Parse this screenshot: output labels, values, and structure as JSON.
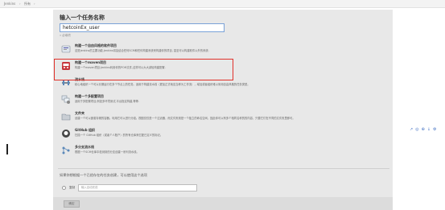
{
  "breadcrumb": {
    "home": "Jenkins",
    "separator": "›",
    "current": "所有",
    "separator2": "›"
  },
  "form": {
    "heading": "输入一个任务名称",
    "item_name": "hetcoinEx_user",
    "required_hint": "» 必填项"
  },
  "job_types": [
    {
      "icon": "freestyle-project-icon",
      "title": "构建一个自由风格的软件项目",
      "desc": "这是Jenkins的主要功能.Jenkins将会结合任何SCM和任何构建系统来构建你的项目, 甚至可以构建软件以外的系统."
    },
    {
      "icon": "maven-project-icon",
      "title": "构建一个maven项目",
      "desc": "构建一个maven项目.Jenkins利用你的POM文件,这样可以大大减轻构建配置."
    },
    {
      "icon": "pipeline-icon",
      "title": "流水线",
      "desc": "精心地组织一个可以长期运行在多个节点上的任务。适用于构建流水线（更加正式地应当称为工作流），增加或者组织难以采用自由风格的任务类型。"
    },
    {
      "icon": "multi-config-icon",
      "title": "构建一个多配置项目",
      "desc": "适用于多配置项目,例如多环境测试,平台指定构建,等等."
    },
    {
      "icon": "folder-icon",
      "title": "文件夹",
      "desc": "创建一个可以嵌套存储的容器。利用它可以进行分组。视图仅仅是一个过滤器，而文件夹则是一个独立的命名空间，因此你可以有多个相同名称的的内容，只要它们在不同的文件夹里即可。"
    },
    {
      "icon": "github-org-icon",
      "title": "GitHub 组织",
      "desc": "扫描一个 GitHub 组织（或者个人账户）的所有仓库来匹配已定义的标记。"
    },
    {
      "icon": "multibranch-icon",
      "title": "多分支流水线",
      "desc": "根据一个SCM仓库中检测到的分支创建一系列流水线。"
    }
  ],
  "copy": {
    "text": "如果你想根据一个已经存在的任务创建，可以使用这个选项",
    "label": "复制",
    "placeholder": "输入自动完成"
  },
  "ok_button": "确定",
  "side_tools": [
    "↗",
    "◎",
    "⊕",
    "↓",
    "⚙"
  ],
  "colors": {
    "highlight": "#e0312a",
    "input_border": "#7aa2d8",
    "panel": "#e8e8e8"
  }
}
